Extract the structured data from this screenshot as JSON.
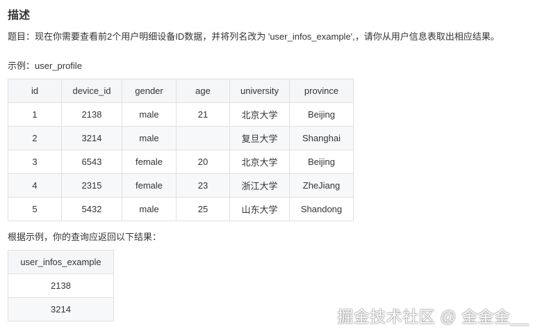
{
  "heading": "描述",
  "description": "题目：现在你需要查看前2个用户明细设备ID数据，并将列名改为 'user_infos_example',，请你从用户信息表取出相应结果。",
  "example_label": "示例：user_profile",
  "profile_table": {
    "columns": [
      "id",
      "device_id",
      "gender",
      "age",
      "university",
      "province"
    ],
    "rows": [
      [
        "1",
        "2138",
        "male",
        "21",
        "北京大学",
        "Beijing"
      ],
      [
        "2",
        "3214",
        "male",
        "",
        "复旦大学",
        "Shanghai"
      ],
      [
        "3",
        "6543",
        "female",
        "20",
        "北京大学",
        "Beijing"
      ],
      [
        "4",
        "2315",
        "female",
        "23",
        "浙江大学",
        "ZheJiang"
      ],
      [
        "5",
        "5432",
        "male",
        "25",
        "山东大学",
        "Shandong"
      ]
    ]
  },
  "result_label": "根据示例，你的查询应返回以下结果：",
  "result_table": {
    "columns": [
      "user_infos_example"
    ],
    "rows": [
      [
        "2138"
      ],
      [
        "3214"
      ]
    ]
  },
  "watermark": "掘金技术社区 @ 金金金__"
}
